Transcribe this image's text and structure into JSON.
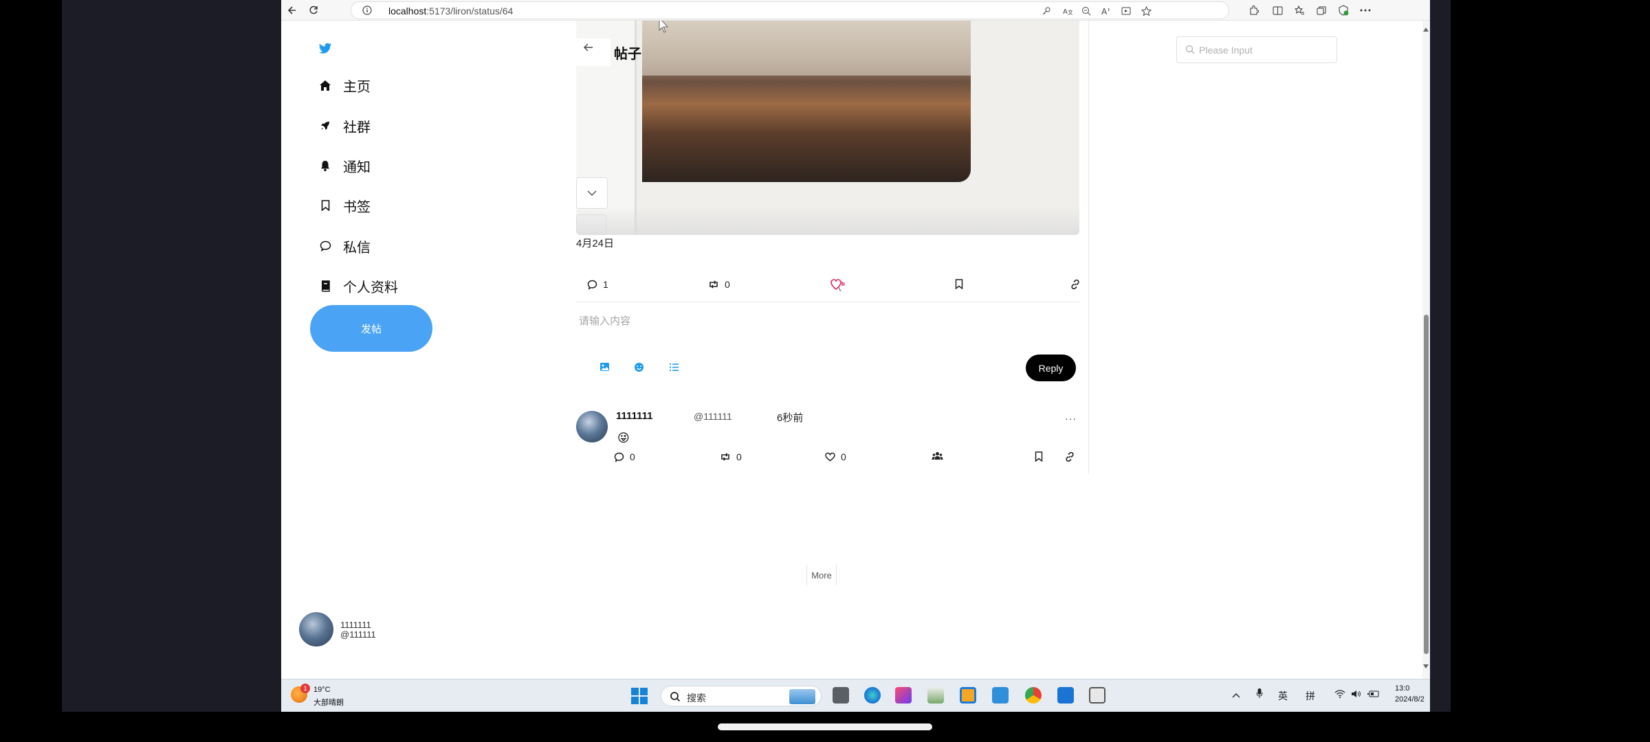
{
  "browser": {
    "url_host": "localhost",
    "url_rest": ":5173/liron/status/64"
  },
  "nav": {
    "items": [
      {
        "label": "主页",
        "icon": "home-icon"
      },
      {
        "label": "社群",
        "icon": "rocket-icon"
      },
      {
        "label": "通知",
        "icon": "bell-icon"
      },
      {
        "label": "书签",
        "icon": "bookmark-icon"
      },
      {
        "label": "私信",
        "icon": "chat-icon"
      },
      {
        "label": "个人资料",
        "icon": "book-icon"
      }
    ],
    "post_button": "发帖",
    "user": {
      "name": "1111111",
      "handle": "@111111"
    }
  },
  "header": {
    "title": "帖子"
  },
  "post": {
    "date": "4月24日",
    "actions": {
      "comments": "1",
      "retweets": "0"
    }
  },
  "reply": {
    "placeholder": "请输入内容",
    "button": "Reply"
  },
  "comment": {
    "name": "1111111",
    "handle": "@111111",
    "time": "6秒前",
    "more": "···",
    "emoji": "😜",
    "actions": {
      "comments": "0",
      "retweets": "0",
      "likes": "0"
    }
  },
  "more_button": "More",
  "search": {
    "placeholder": "Please Input"
  },
  "taskbar": {
    "weather_badge": "1",
    "weather_temp": "19°C",
    "weather_desc": "大部晴朗",
    "search_text": "搜索",
    "ime_1": "英",
    "ime_2": "拼",
    "clock_time": "13:0",
    "clock_date": "2024/8/2"
  },
  "colors": {
    "accent": "#4aa3f5",
    "twitter": "#1d9bf0",
    "like_red": "#e0245e"
  }
}
